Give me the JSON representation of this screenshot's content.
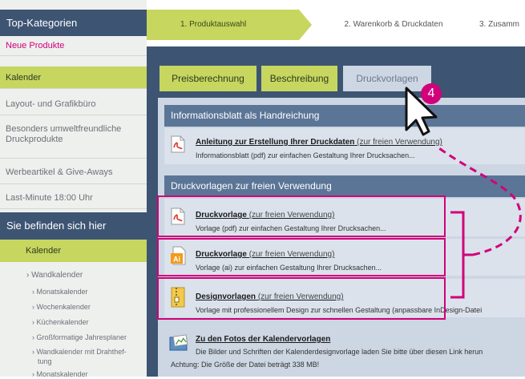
{
  "sidebar": {
    "title": "Top-Kategorien",
    "items": [
      {
        "label": "Neue Produkte"
      },
      {
        "label": "Kalender"
      },
      {
        "label": "Layout- und Grafikbüro"
      },
      {
        "label": "Besonders umweltfreundliche Druckprodukte"
      },
      {
        "label": "Werbeartikel & Give-Aways"
      },
      {
        "label": "Last-Minute 18:00 Uhr"
      }
    ],
    "location_heading": "Sie befinden sich hier",
    "location_current": "Kalender",
    "location_child": "› Wandkalender",
    "location_grandchildren": [
      "› Monatskalender",
      "› Wochenkalender",
      "› Küchenkalender",
      "› Großformatige Jahresplaner",
      "› Wandkalender mit Drahthef-",
      "tung",
      "› Monatskalender"
    ]
  },
  "steps": {
    "step1": "1. Produktauswahl",
    "step2": "2. Warenkorb & Druckdaten",
    "step3": "3. Zusamm"
  },
  "tabs": {
    "tab1": "Preisberechnung",
    "tab2": "Beschreibung",
    "tab3": "Druckvorlagen"
  },
  "annotation": {
    "badge": "4"
  },
  "section1": {
    "heading": "Informationsblatt als Handreichung",
    "item": {
      "title": "Anleitung zur Erstellung Ihrer Druckdaten",
      "suffix": "(zur freien Verwendung)",
      "desc": "Informationsblatt (pdf) zur einfachen Gestaltung Ihrer Drucksachen..."
    }
  },
  "section2": {
    "heading": "Druckvorlagen zur freien Verwendung",
    "items": [
      {
        "title": "Druckvorlage",
        "suffix": "(zur freien Verwendung)",
        "desc": "Vorlage (pdf) zur einfachen Gestaltung Ihrer Drucksachen..."
      },
      {
        "title": "Druckvorlage",
        "suffix": "(zur freien Verwendung)",
        "desc": "Vorlage (ai) zur einfachen Gestaltung Ihrer Drucksachen..."
      },
      {
        "title": "Designvorlagen",
        "suffix": "(zur freien Verwendung)",
        "desc": "Vorlage mit professionellem Design zur schnellen Gestaltung (anpassbare InDesign-Datei"
      }
    ],
    "photos": {
      "title": "Zu den Fotos der Kalendervorlagen",
      "desc": "Die Bilder und Schriften der Kalenderdesignvorlage laden Sie bitte über diesen Link herun",
      "note": "Achtung: Die Größe der Datei beträgt 338 MB!"
    }
  },
  "colors": {
    "navy": "#3d5573",
    "green": "#c6d65f",
    "magenta": "#d1007a",
    "panel": "#cdd6e3",
    "section_head": "#5b7597"
  }
}
